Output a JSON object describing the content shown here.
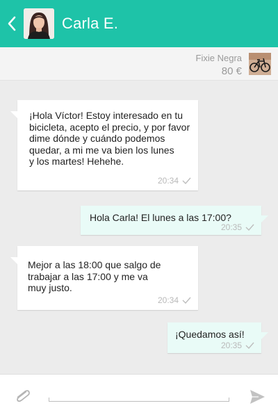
{
  "header": {
    "contact_name": "Carla E.",
    "back_icon": "chevron-left-icon",
    "background_color": "#1ec3a8"
  },
  "product": {
    "name": "Fixie Negra",
    "price": "80 €"
  },
  "messages": [
    {
      "direction": "incoming",
      "text": "¡Hola Víctor! Estoy interesado en tu\nbicicleta, acepto el precio, y por favor\ndime dónde y cuándo podemos\nquedar, a mi me va bien los lunes\ny los martes! Hehehe.",
      "time": "20:34"
    },
    {
      "direction": "outgoing",
      "text": "Hola Carla! El lunes a las 17:00?",
      "time": "20:35"
    },
    {
      "direction": "incoming",
      "text": "Mejor a las 18:00 que salgo de\ntrabajar a las 17:00 y me va\nmuy justo.",
      "time": "20:34"
    },
    {
      "direction": "outgoing",
      "text": "¡Quedamos así!",
      "time": "20:35"
    }
  ],
  "composer": {
    "placeholder": "",
    "attach_icon": "paperclip-icon",
    "send_icon": "send-icon"
  }
}
